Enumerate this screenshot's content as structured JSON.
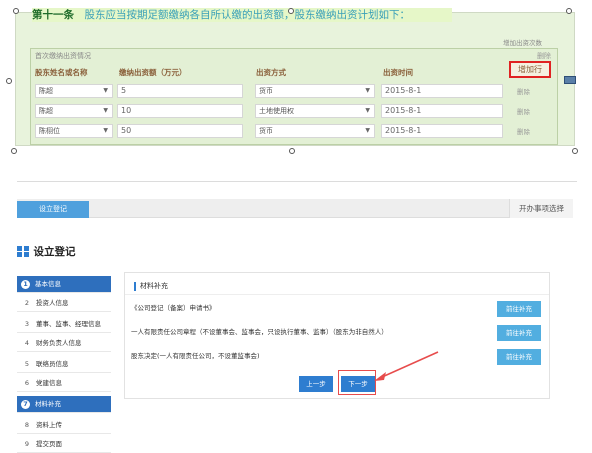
{
  "editor": {
    "clause_label": "第十一条",
    "clause_text": "股东应当按期足额缴纳各自所认缴的出资额，股东缴纳出资计划如下：",
    "add_times_link": "增加出资次数",
    "table_title": "首次缴纳出资情况",
    "table_delete": "删除",
    "headers": [
      "股东姓名或名称",
      "缴纳出资额（万元）",
      "出资方式",
      "出资时间"
    ],
    "add_row_label": "增加行",
    "rows": [
      {
        "name": "陈超",
        "amount": "5",
        "method": "货币",
        "date": "2015-8-1",
        "delete": "删除"
      },
      {
        "name": "陈超",
        "amount": "10",
        "method": "土地使用权",
        "date": "2015-8-1",
        "delete": "删除"
      },
      {
        "name": "陈栩位",
        "amount": "50",
        "method": "货币",
        "date": "2015-8-1",
        "delete": "删除"
      }
    ]
  },
  "tabs": {
    "register": "设立登记",
    "select": "开办事项选择"
  },
  "page_title": "设立登记",
  "sidebar": {
    "items": [
      {
        "num": "1",
        "label": "基本信息",
        "active": true
      },
      {
        "num": "2",
        "label": "投资人信息",
        "active": false
      },
      {
        "num": "3",
        "label": "董事、监事、经理信息",
        "active": false
      },
      {
        "num": "4",
        "label": "财务负责人信息",
        "active": false
      },
      {
        "num": "5",
        "label": "联络员信息",
        "active": false
      },
      {
        "num": "6",
        "label": "党建信息",
        "active": false
      },
      {
        "num": "7",
        "label": "材料补充",
        "active": true
      },
      {
        "num": "8",
        "label": "资料上传",
        "active": false
      },
      {
        "num": "9",
        "label": "提交页面",
        "active": false
      }
    ]
  },
  "content": {
    "section_title": "材料补充",
    "materials": [
      {
        "text": "《公司登记（备案）申请书》",
        "button": "前往补充"
      },
      {
        "text": "一人有限责任公司章程（不设董事会、监事会，只设执行董事、监事）（股东为非自然人）",
        "button": "前往补充"
      },
      {
        "text": "股东决定(一人有限责任公司，不设董监事会)",
        "button": "前往补充"
      }
    ],
    "prev_label": "上一步",
    "next_label": "下一步"
  },
  "colors": {
    "accent": "#2e7dd0",
    "highlight": "#e02222",
    "editor_bg": "#e8f3dc"
  }
}
